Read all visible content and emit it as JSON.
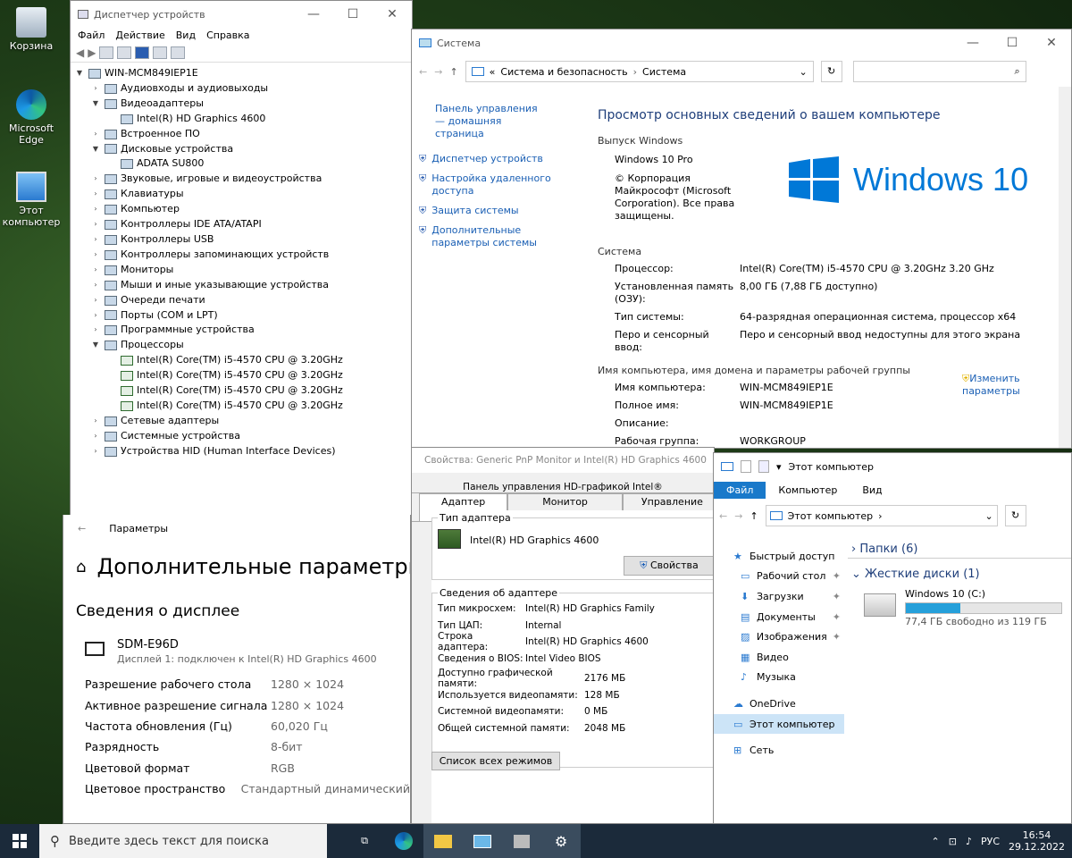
{
  "desktop": {
    "icons": [
      {
        "label": "Корзина"
      },
      {
        "label": "Microsoft Edge"
      },
      {
        "label": "Этот компьютер"
      }
    ]
  },
  "devmgr": {
    "title": "Диспетчер устройств",
    "menu": [
      "Файл",
      "Действие",
      "Вид",
      "Справка"
    ],
    "root": "WIN-MCM849IEP1E",
    "items": [
      {
        "label": "Аудиовходы и аудиовыходы",
        "level": 1,
        "state": "c"
      },
      {
        "label": "Видеоадаптеры",
        "level": 1,
        "state": "e"
      },
      {
        "label": "Intel(R) HD Graphics 4600",
        "level": 2,
        "state": "n"
      },
      {
        "label": "Встроенное ПО",
        "level": 1,
        "state": "c"
      },
      {
        "label": "Дисковые устройства",
        "level": 1,
        "state": "e"
      },
      {
        "label": "ADATA SU800",
        "level": 2,
        "state": "n"
      },
      {
        "label": "Звуковые, игровые и видеоустройства",
        "level": 1,
        "state": "c"
      },
      {
        "label": "Клавиатуры",
        "level": 1,
        "state": "c"
      },
      {
        "label": "Компьютер",
        "level": 1,
        "state": "c"
      },
      {
        "label": "Контроллеры IDE ATA/ATAPI",
        "level": 1,
        "state": "c"
      },
      {
        "label": "Контроллеры USB",
        "level": 1,
        "state": "c"
      },
      {
        "label": "Контроллеры запоминающих устройств",
        "level": 1,
        "state": "c"
      },
      {
        "label": "Мониторы",
        "level": 1,
        "state": "c"
      },
      {
        "label": "Мыши и иные указывающие устройства",
        "level": 1,
        "state": "c"
      },
      {
        "label": "Очереди печати",
        "level": 1,
        "state": "c"
      },
      {
        "label": "Порты (COM и LPT)",
        "level": 1,
        "state": "c"
      },
      {
        "label": "Программные устройства",
        "level": 1,
        "state": "c"
      },
      {
        "label": "Процессоры",
        "level": 1,
        "state": "e"
      },
      {
        "label": "Intel(R) Core(TM) i5-4570 CPU @ 3.20GHz",
        "level": 2,
        "state": "n",
        "cpu": true
      },
      {
        "label": "Intel(R) Core(TM) i5-4570 CPU @ 3.20GHz",
        "level": 2,
        "state": "n",
        "cpu": true
      },
      {
        "label": "Intel(R) Core(TM) i5-4570 CPU @ 3.20GHz",
        "level": 2,
        "state": "n",
        "cpu": true
      },
      {
        "label": "Intel(R) Core(TM) i5-4570 CPU @ 3.20GHz",
        "level": 2,
        "state": "n",
        "cpu": true
      },
      {
        "label": "Сетевые адаптеры",
        "level": 1,
        "state": "c"
      },
      {
        "label": "Системные устройства",
        "level": 1,
        "state": "c"
      },
      {
        "label": "Устройства HID (Human Interface Devices)",
        "level": 1,
        "state": "c"
      }
    ]
  },
  "system": {
    "title": "Система",
    "breadcrumb_prefix": "«",
    "breadcrumb": [
      "Система и безопасность",
      "Система"
    ],
    "side_home": "Панель управления — домашняя страница",
    "side_links": [
      "Диспетчер устройств",
      "Настройка удаленного доступа",
      "Защита системы",
      "Дополнительные параметры системы"
    ],
    "heading": "Просмотр основных сведений о вашем компьютере",
    "edition_title": "Выпуск Windows",
    "edition": "Windows 10 Pro",
    "copyright": "© Корпорация Майкрософт (Microsoft Corporation). Все права защищены.",
    "logo_text": "Windows 10",
    "system_title": "Система",
    "rows": [
      {
        "k": "Процессор:",
        "v": "Intel(R) Core(TM) i5-4570 CPU @ 3.20GHz   3.20 GHz"
      },
      {
        "k": "Установленная память (ОЗУ):",
        "v": "8,00 ГБ (7,88 ГБ доступно)"
      },
      {
        "k": "Тип системы:",
        "v": "64-разрядная операционная система, процессор x64"
      },
      {
        "k": "Перо и сенсорный ввод:",
        "v": "Перо и сенсорный ввод недоступны для этого экрана"
      }
    ],
    "name_title": "Имя компьютера, имя домена и параметры рабочей группы",
    "name_rows": [
      {
        "k": "Имя компьютера:",
        "v": "WIN-MCM849IEP1E"
      },
      {
        "k": "Полное имя:",
        "v": "WIN-MCM849IEP1E"
      },
      {
        "k": "Описание:",
        "v": ""
      },
      {
        "k": "Рабочая группа:",
        "v": "WORKGROUP"
      }
    ],
    "change": "Изменить параметры"
  },
  "props": {
    "title": "Свойства: Generic PnP Monitor и Intel(R) HD Graphics 4600",
    "tabs_top": [
      "Панель управления HD-графикой Intel®"
    ],
    "tabs": [
      "Адаптер",
      "Монитор",
      "Управление ц"
    ],
    "type_group": "Тип адаптера",
    "adapter": "Intel(R) HD Graphics 4600",
    "props_btn": "Свойства",
    "info_group": "Сведения об адаптере",
    "info": [
      {
        "k": "Тип микросхем:",
        "v": "Intel(R) HD Graphics Family"
      },
      {
        "k": "Тип ЦАП:",
        "v": "Internal"
      },
      {
        "k": "Строка адаптера:",
        "v": "Intel(R) HD Graphics 4600"
      },
      {
        "k": "Сведения о BIOS:",
        "v": "Intel Video BIOS"
      }
    ],
    "mem": [
      {
        "k": "Доступно графической памяти:",
        "v": "2176 МБ"
      },
      {
        "k": "Используется видеопамяти:",
        "v": "128 МБ"
      },
      {
        "k": "Системной видеопамяти:",
        "v": "0 МБ"
      },
      {
        "k": "Общей системной памяти:",
        "v": "2048 МБ"
      }
    ],
    "modes_btn": "Список всех режимов"
  },
  "settings": {
    "title": "Параметры",
    "heading": "Дополнительные параметры",
    "section": "Сведения о дисплее",
    "monitor": "SDM-E96D",
    "monitor_sub": "Дисплей 1: подключен к Intel(R) HD Graphics 4600",
    "rows": [
      {
        "k": "Разрешение рабочего стола",
        "v": "1280 × 1024"
      },
      {
        "k": "Активное разрешение сигнала",
        "v": "1280 × 1024"
      },
      {
        "k": "Частота обновления (Гц)",
        "v": "60,020 Гц"
      },
      {
        "k": "Разрядность",
        "v": "8-бит"
      },
      {
        "k": "Цветовой формат",
        "v": "RGB"
      },
      {
        "k": "Цветовое пространство",
        "v": "Стандартный динамический"
      }
    ]
  },
  "explorer": {
    "title": "Этот компьютер",
    "ribbon": [
      "Файл",
      "Компьютер",
      "Вид"
    ],
    "address": "Этот компьютер",
    "nav": [
      "Быстрый доступ",
      "Рабочий стол",
      "Загрузки",
      "Документы",
      "Изображения",
      "Видео",
      "Музыка",
      "OneDrive",
      "Этот компьютер",
      "Сеть"
    ],
    "folders": "Папки (6)",
    "drives": "Жесткие диски (1)",
    "drive_name": "Windows 10 (C:)",
    "drive_free": "77,4 ГБ свободно из 119 ГБ",
    "drive_used_fraction": 0.35
  },
  "taskbar": {
    "search": "Введите здесь текст для поиска",
    "lang": "РУС",
    "time": "16:54",
    "date": "29.12.2022"
  },
  "colors": {
    "accent": "#0078d7",
    "link": "#1a5fb4",
    "taskbar": "#1b2a3a"
  }
}
